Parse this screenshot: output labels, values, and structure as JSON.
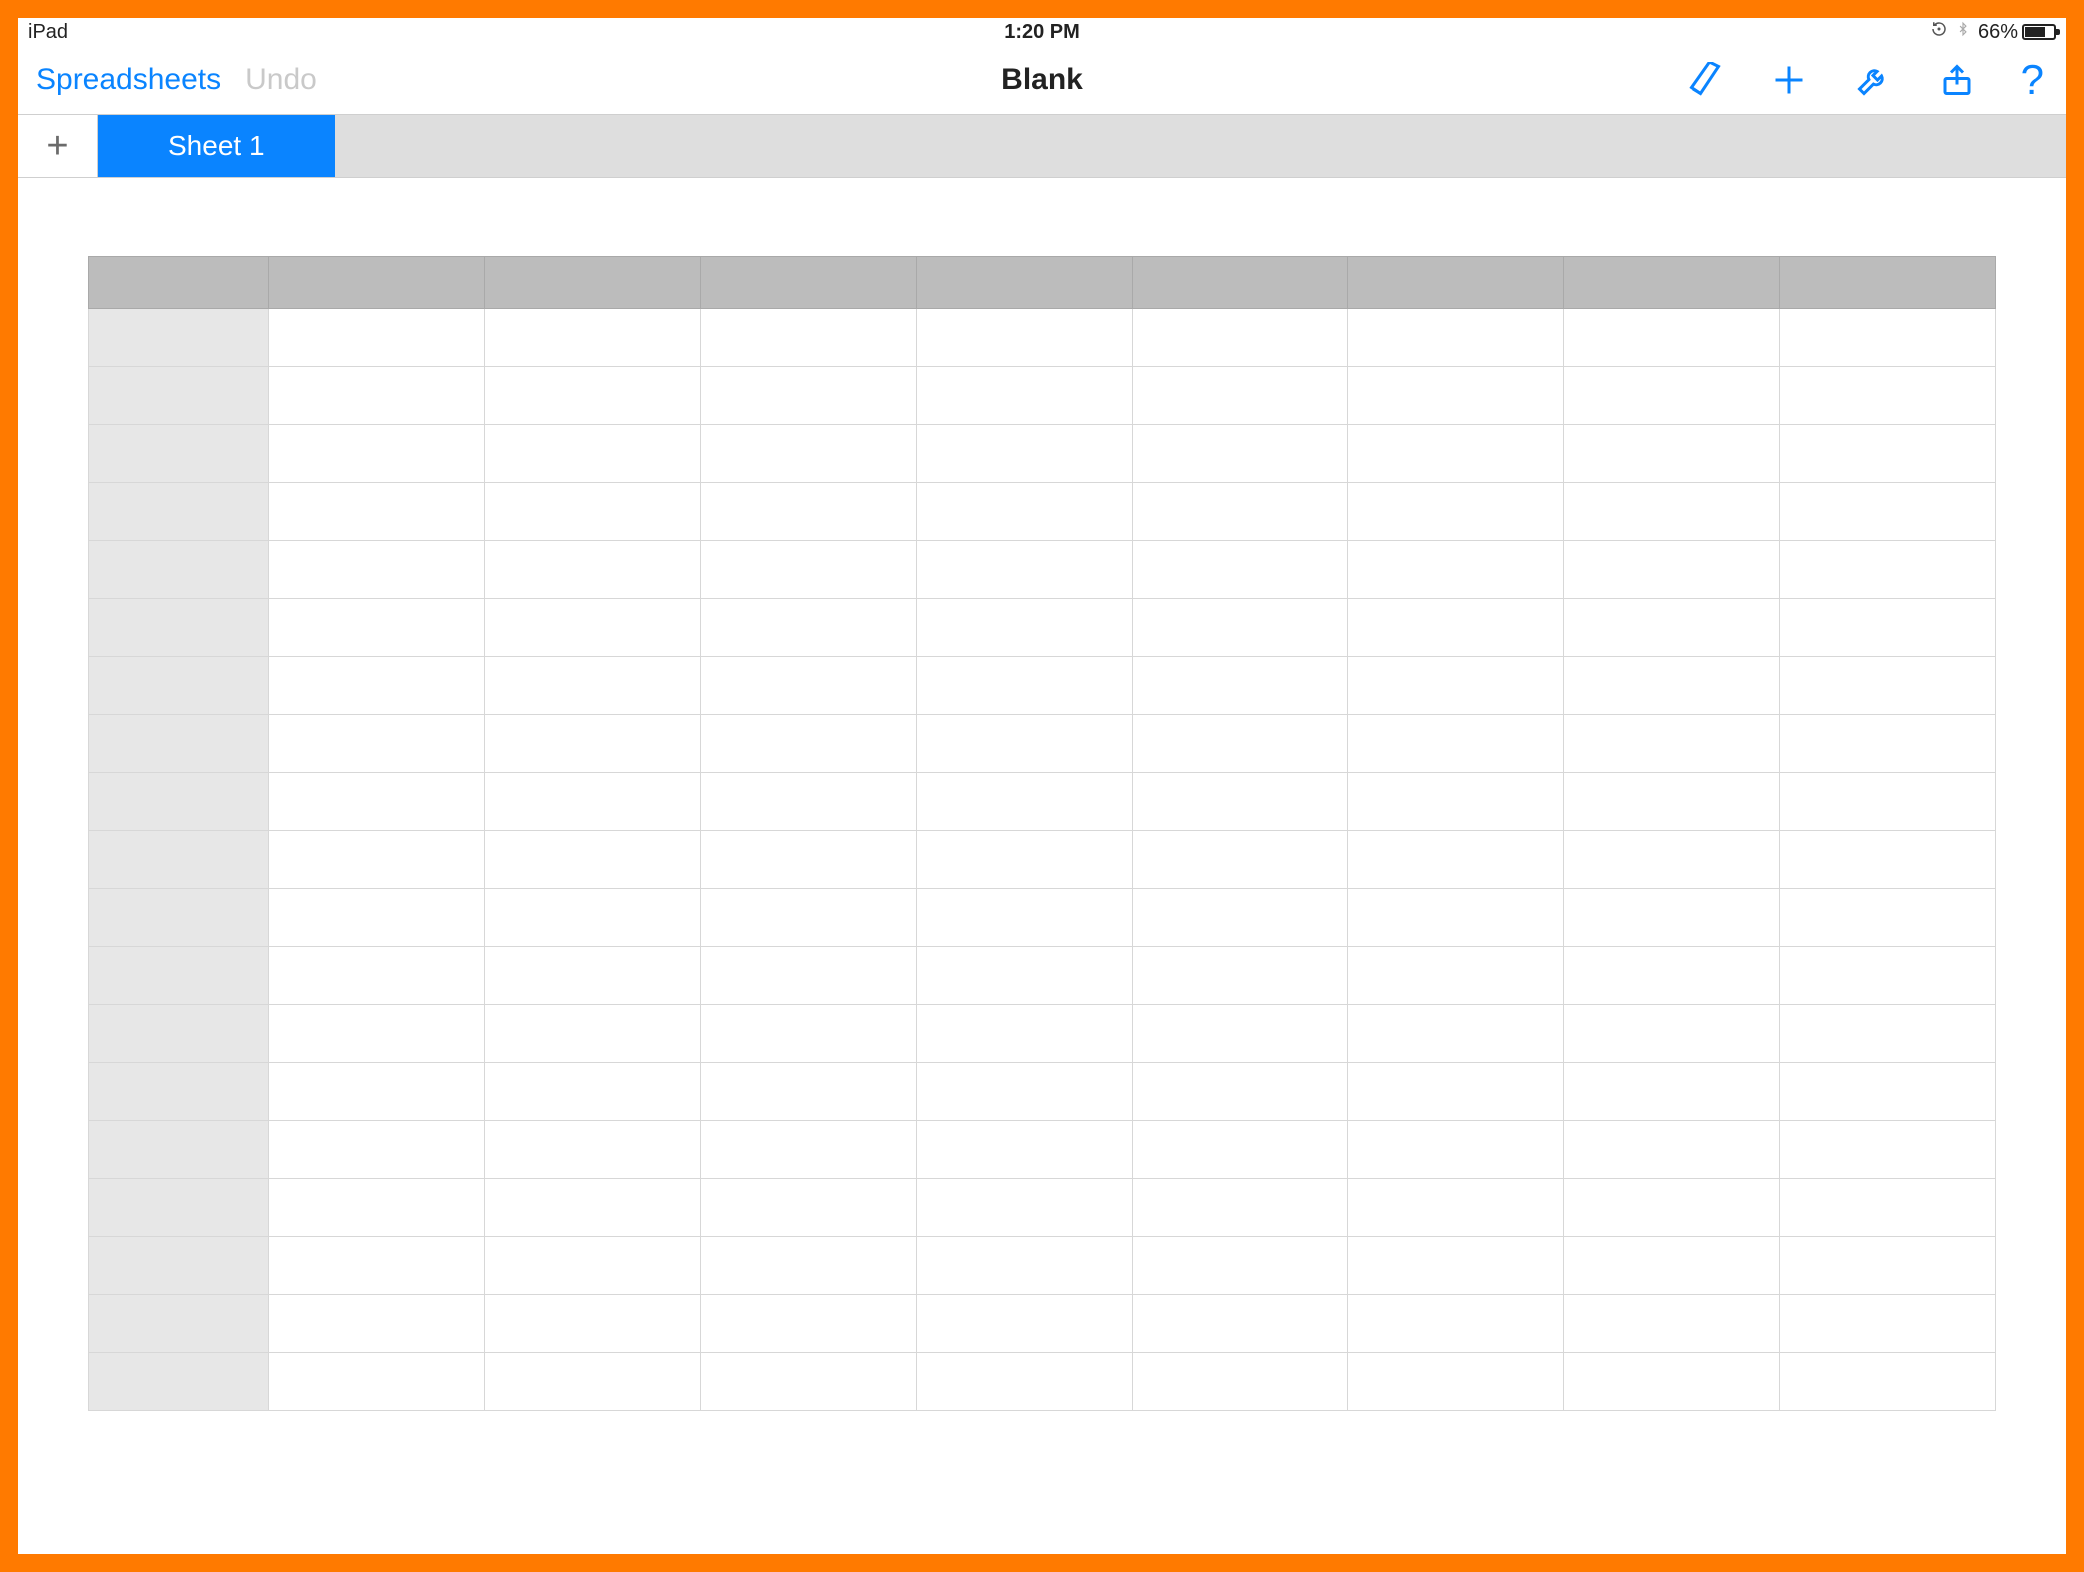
{
  "status": {
    "device": "iPad",
    "time": "1:20 PM",
    "battery_percent": "66%"
  },
  "toolbar": {
    "back_label": "Spreadsheets",
    "undo_label": "Undo",
    "doc_title": "Blank",
    "help_label": "?"
  },
  "tabs": {
    "add_label": "+",
    "active_sheet_label": "Sheet 1"
  },
  "grid": {
    "columns": 9,
    "rows": 19
  }
}
